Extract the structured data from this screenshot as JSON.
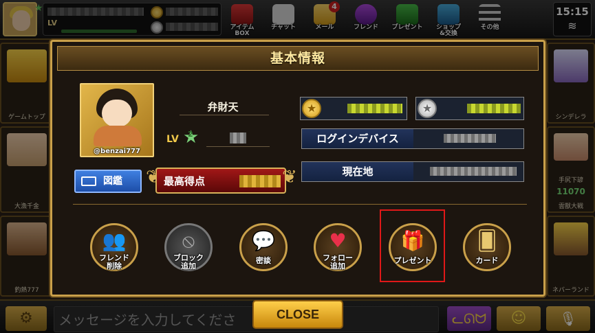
{
  "topbar": {
    "player_level_label": "LV",
    "menu": [
      {
        "label_line1": "アイテム",
        "label_line2": "BOX",
        "icon": "item-box-icon"
      },
      {
        "label_line1": "チャット",
        "label_line2": "",
        "icon": "chat-icon"
      },
      {
        "label_line1": "メール",
        "label_line2": "",
        "icon": "mail-icon",
        "badge": "4"
      },
      {
        "label_line1": "フレンド",
        "label_line2": "",
        "icon": "friends-icon"
      },
      {
        "label_line1": "プレゼント",
        "label_line2": "",
        "icon": "gift-icon"
      },
      {
        "label_line1": "ショップ",
        "label_line2": "&交換",
        "icon": "shop-icon"
      },
      {
        "label_line1": "その他",
        "label_line2": "",
        "icon": "menu-icon"
      }
    ],
    "clock": "15:15",
    "wifi_icon": "wifi-icon"
  },
  "background_sides": {
    "left": [
      "ゲームトップ",
      "大漁千金",
      "釣熱777"
    ],
    "right": [
      "シンデレラ",
      "手尻下諺",
      "11070",
      "雲獣大戦",
      "ネバーランド"
    ]
  },
  "modal": {
    "title": "基本情報",
    "profile": {
      "handle": "@benzai777",
      "name": "弁財天",
      "level_label": "LV",
      "level": "2"
    },
    "zukan_button": "図鑑",
    "best_score_label": "最高得点",
    "info_rows": [
      {
        "label": "ログインデバイス"
      },
      {
        "label": "現在地"
      }
    ],
    "actions": [
      {
        "line1": "フレンド",
        "line2": "削除",
        "icon": "friend-remove-icon"
      },
      {
        "line1": "ブロック",
        "line2": "追加",
        "icon": "block-icon"
      },
      {
        "line1": "密談",
        "line2": "",
        "icon": "whisper-icon"
      },
      {
        "line1": "フォロー",
        "line2": "追加",
        "icon": "follow-icon"
      },
      {
        "line1": "プレゼント",
        "line2": "",
        "icon": "present-icon"
      },
      {
        "line1": "カード",
        "line2": "",
        "icon": "card-icon"
      }
    ],
    "close_button": "CLOSE"
  },
  "bottombar": {
    "chat_placeholder": "メッセージを入力してくださ"
  },
  "colors": {
    "gold": "#c9a04a",
    "modal_bg": "#1c150f",
    "score_red": "#a11717",
    "highlight": "#e01818",
    "zukan_blue": "#3f7fe0"
  }
}
